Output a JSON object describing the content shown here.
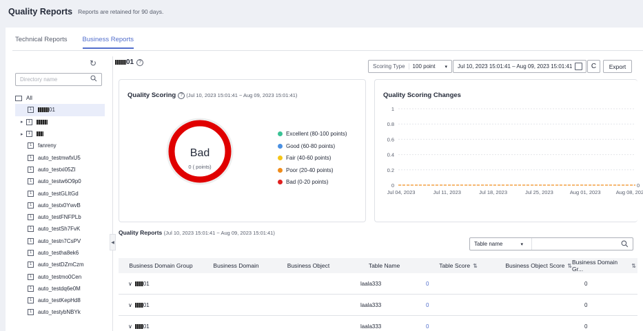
{
  "header": {
    "title": "Quality Reports",
    "subtitle": "Reports are retained for 90 days."
  },
  "tabs": [
    {
      "label": "Technical Reports",
      "active": false
    },
    {
      "label": "Business Reports",
      "active": true
    }
  ],
  "sidebar": {
    "search_placeholder": "Directory name",
    "root_label": "All",
    "items": [
      {
        "label": "01",
        "blurred": true,
        "selected": true,
        "expandable": false
      },
      {
        "label": "",
        "blurred": true,
        "selected": false,
        "expandable": true
      },
      {
        "label": "",
        "blurred": true,
        "selected": false,
        "expandable": true
      },
      {
        "label": "fanreny"
      },
      {
        "label": "auto_testmwfxU5"
      },
      {
        "label": "auto_testxi05ZI"
      },
      {
        "label": "auto_testw6O9p0"
      },
      {
        "label": "auto_testGLItGd"
      },
      {
        "label": "auto_testx0YwvB"
      },
      {
        "label": "auto_testFNFPLb"
      },
      {
        "label": "auto_testSh7FvK"
      },
      {
        "label": "auto_testn7CsPV"
      },
      {
        "label": "auto_testha8ek6"
      },
      {
        "label": "auto_testDZmCzm"
      },
      {
        "label": "auto_testmo0Cen"
      },
      {
        "label": "auto_testdq6e0M"
      },
      {
        "label": "auto_testKepHd8"
      },
      {
        "label": "auto_testybNBYk"
      }
    ]
  },
  "main": {
    "title_suffix": "01",
    "scoring_type_label": "Scoring Type",
    "scoring_type_value": "100 point",
    "date_range": "Jul 10, 2023 15:01:41 – Aug 09, 2023 15:01:41",
    "export_label": "Export"
  },
  "scoring_card": {
    "title": "Quality Scoring",
    "range": "(Jul 10, 2023 15:01:41 ~ Aug 09, 2023 15:01:41)",
    "grade": "Bad",
    "points": "0 ( points)",
    "legend": [
      {
        "label": "Excellent (80-100 points)",
        "color": "#3ac295"
      },
      {
        "label": "Good (60-80 points)",
        "color": "#4a90e2"
      },
      {
        "label": "Fair (40-60 points)",
        "color": "#f5c518"
      },
      {
        "label": "Poor (20-40 points)",
        "color": "#f08c1a"
      },
      {
        "label": "Bad (0-20 points)",
        "color": "#e02020"
      }
    ],
    "ring_color": "#e00000"
  },
  "chart_data": {
    "type": "line",
    "title": "Quality Scoring Changes",
    "x_ticks": [
      "Jul 04, 2023",
      "Jul 11, 2023",
      "Jul 18, 2023",
      "Jul 25, 2023",
      "Aug 01, 2023",
      "Aug 08, 2023"
    ],
    "y_ticks": [
      "1",
      "0.8",
      "0.6",
      "0.4",
      "0.2",
      "0"
    ],
    "ylim": [
      0,
      1
    ],
    "series": [
      {
        "values": [
          0,
          0,
          0,
          0,
          0,
          0
        ],
        "color": "#f08c1a",
        "style": "dashed"
      }
    ],
    "end_label": "0",
    "grid": true
  },
  "reports": {
    "title": "Quality Reports",
    "range": "(Jul 10, 2023 15:01:41 ~ Aug 09, 2023 15:01:41)",
    "filter_field": "Table name",
    "columns": [
      "Business Domain Group",
      "Business Domain",
      "Business Object",
      "Table Name",
      "Table Score",
      "Business Object Score",
      "Business Domain Gr..."
    ],
    "rows": [
      {
        "group": "01",
        "domain": "",
        "object": "",
        "table": "laala333",
        "table_score": "0",
        "object_score": "",
        "group_score": "0"
      },
      {
        "group": "01",
        "domain": "",
        "object": "",
        "table": "laala333",
        "table_score": "0",
        "object_score": "",
        "group_score": "0"
      },
      {
        "group": "01",
        "domain": "",
        "object": "",
        "table": "laala333",
        "table_score": "0",
        "object_score": "",
        "group_score": "0"
      }
    ]
  }
}
